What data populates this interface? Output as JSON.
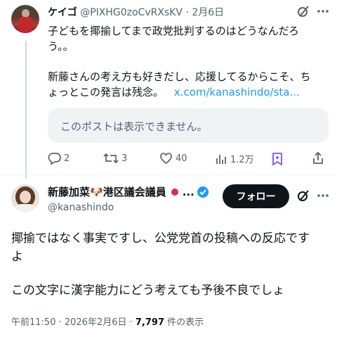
{
  "reply": {
    "name": "ケイゴ",
    "handle": "@PIXHG0zoCvRXsKV",
    "dot": "·",
    "date": "2月6日",
    "line1": "子どもを揶揄してまで政党批判するのはどうなんだろ",
    "line2": "う。。",
    "line3": "新藤さんの考え方も好きだし、応援してるからこそ、ち",
    "line4_text": "ょっとこの発言は残念。",
    "line4_link": "x.com/kanashindo/sta...",
    "quote_unavailable": "このポストは表示できません。",
    "actions": {
      "replies": "2",
      "reposts": "3",
      "likes": "40",
      "views": "1.2万"
    }
  },
  "main": {
    "name": "新藤加菜",
    "name_suffix": "港区議会議員",
    "emoji_dog": "🐶",
    "emoji_flag": "●",
    "ellipsis": "...",
    "handle": "@kanashindo",
    "follow_label": "フォロー",
    "text_line1": "揶揄ではなく事実ですし、公党党首の投稿への反応です",
    "text_line2": "よ",
    "text_line3": "この文字に漢字能力にどう考えても予後不良でしょ",
    "meta_time": "午前11:50 · 2026年2月6日 · ",
    "meta_views": "7,797",
    "meta_views_suffix": " 件の表示"
  },
  "colors": {
    "accent": "#1d9bf0",
    "text": "#0f1419",
    "muted": "#536471",
    "bookmark": "#7856ff",
    "follow_bg": "#0f1419"
  }
}
